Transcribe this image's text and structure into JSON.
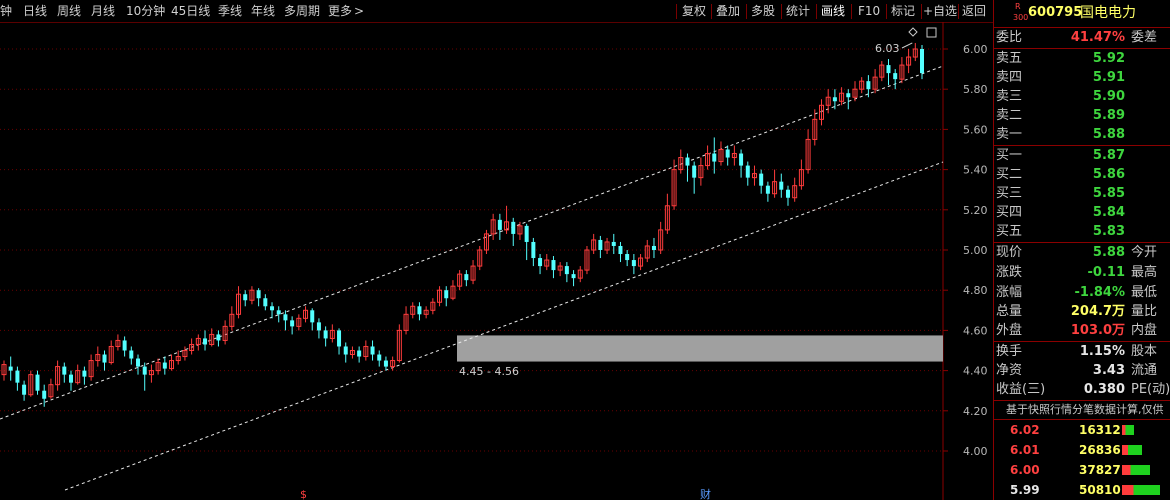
{
  "toolbar": {
    "periods": [
      "钟",
      "日线",
      "周线",
      "月线",
      "10分钟",
      "45日线",
      "季线",
      "年线",
      "多周期",
      "更多"
    ],
    "more_chevron": ">",
    "buttons": [
      "复权",
      "叠加",
      "多股",
      "统计",
      "画线",
      "F10",
      "标记",
      "+自选",
      "返回"
    ],
    "active_button": "画线"
  },
  "chart_data": {
    "type": "candlestick",
    "price_axis": [
      "6.00",
      "5.80",
      "5.60",
      "5.40",
      "5.20",
      "5.00",
      "4.80",
      "4.60",
      "4.40",
      "4.20",
      "4.00"
    ],
    "ylim": [
      3.9,
      6.1
    ],
    "high_label": "6.03",
    "zone_label": "4.45 - 4.56",
    "zone_range": [
      4.45,
      4.56
    ],
    "event_markers": [
      "$",
      "财"
    ],
    "candles": [
      [
        4.38,
        4.43,
        4.35,
        4.45
      ],
      [
        4.42,
        4.4,
        4.35,
        4.47
      ],
      [
        4.4,
        4.34,
        4.3,
        4.42
      ],
      [
        4.33,
        4.28,
        4.25,
        4.35
      ],
      [
        4.28,
        4.38,
        4.27,
        4.4
      ],
      [
        4.38,
        4.3,
        4.28,
        4.4
      ],
      [
        4.3,
        4.26,
        4.22,
        4.33
      ],
      [
        4.27,
        4.33,
        4.26,
        4.36
      ],
      [
        4.33,
        4.42,
        4.3,
        4.45
      ],
      [
        4.42,
        4.38,
        4.34,
        4.44
      ],
      [
        4.38,
        4.34,
        4.3,
        4.4
      ],
      [
        4.34,
        4.4,
        4.33,
        4.43
      ],
      [
        4.4,
        4.37,
        4.33,
        4.42
      ],
      [
        4.37,
        4.45,
        4.35,
        4.48
      ],
      [
        4.45,
        4.48,
        4.42,
        4.52
      ],
      [
        4.48,
        4.44,
        4.4,
        4.5
      ],
      [
        4.44,
        4.52,
        4.43,
        4.55
      ],
      [
        4.52,
        4.55,
        4.5,
        4.58
      ],
      [
        4.55,
        4.5,
        4.47,
        4.57
      ],
      [
        4.5,
        4.46,
        4.43,
        4.52
      ],
      [
        4.46,
        4.42,
        4.38,
        4.48
      ],
      [
        4.42,
        4.38,
        4.3,
        4.44
      ],
      [
        4.38,
        4.4,
        4.34,
        4.43
      ],
      [
        4.4,
        4.44,
        4.38,
        4.46
      ],
      [
        4.44,
        4.41,
        4.38,
        4.47
      ],
      [
        4.41,
        4.45,
        4.4,
        4.48
      ],
      [
        4.45,
        4.47,
        4.43,
        4.5
      ],
      [
        4.47,
        4.5,
        4.45,
        4.52
      ],
      [
        4.5,
        4.53,
        4.48,
        4.56
      ],
      [
        4.53,
        4.56,
        4.5,
        4.58
      ],
      [
        4.56,
        4.53,
        4.5,
        4.6
      ],
      [
        4.53,
        4.58,
        4.52,
        4.61
      ],
      [
        4.58,
        4.55,
        4.52,
        4.6
      ],
      [
        4.55,
        4.62,
        4.53,
        4.65
      ],
      [
        4.62,
        4.68,
        4.6,
        4.72
      ],
      [
        4.68,
        4.78,
        4.66,
        4.82
      ],
      [
        4.78,
        4.75,
        4.72,
        4.8
      ],
      [
        4.75,
        4.8,
        4.73,
        4.82
      ],
      [
        4.8,
        4.76,
        4.72,
        4.81
      ],
      [
        4.76,
        4.72,
        4.7,
        4.78
      ],
      [
        4.72,
        4.7,
        4.66,
        4.74
      ],
      [
        4.7,
        4.68,
        4.64,
        4.72
      ],
      [
        4.68,
        4.65,
        4.6,
        4.7
      ],
      [
        4.65,
        4.62,
        4.58,
        4.67
      ],
      [
        4.62,
        4.66,
        4.6,
        4.68
      ],
      [
        4.66,
        4.7,
        4.64,
        4.72
      ],
      [
        4.7,
        4.64,
        4.6,
        4.71
      ],
      [
        4.64,
        4.6,
        4.56,
        4.66
      ],
      [
        4.6,
        4.56,
        4.52,
        4.62
      ],
      [
        4.56,
        4.6,
        4.54,
        4.63
      ],
      [
        4.6,
        4.52,
        4.48,
        4.61
      ],
      [
        4.52,
        4.48,
        4.44,
        4.54
      ],
      [
        4.48,
        4.5,
        4.46,
        4.52
      ],
      [
        4.5,
        4.47,
        4.44,
        4.52
      ],
      [
        4.47,
        4.52,
        4.45,
        4.55
      ],
      [
        4.52,
        4.48,
        4.45,
        4.55
      ],
      [
        4.48,
        4.45,
        4.42,
        4.5
      ],
      [
        4.45,
        4.42,
        4.4,
        4.47
      ],
      [
        4.42,
        4.45,
        4.4,
        4.47
      ],
      [
        4.45,
        4.6,
        4.44,
        4.63
      ],
      [
        4.6,
        4.68,
        4.58,
        4.72
      ],
      [
        4.68,
        4.72,
        4.66,
        4.74
      ],
      [
        4.72,
        4.68,
        4.65,
        4.74
      ],
      [
        4.68,
        4.7,
        4.66,
        4.72
      ],
      [
        4.7,
        4.74,
        4.68,
        4.76
      ],
      [
        4.74,
        4.8,
        4.72,
        4.82
      ],
      [
        4.8,
        4.76,
        4.72,
        4.82
      ],
      [
        4.76,
        4.82,
        4.75,
        4.85
      ],
      [
        4.82,
        4.88,
        4.8,
        4.9
      ],
      [
        4.88,
        4.85,
        4.82,
        4.9
      ],
      [
        4.85,
        4.92,
        4.83,
        4.95
      ],
      [
        4.92,
        5.0,
        4.9,
        5.02
      ],
      [
        5.0,
        5.08,
        4.98,
        5.1
      ],
      [
        5.08,
        5.15,
        5.05,
        5.18
      ],
      [
        5.15,
        5.1,
        5.05,
        5.18
      ],
      [
        5.1,
        5.14,
        5.08,
        5.22
      ],
      [
        5.14,
        5.08,
        5.02,
        5.16
      ],
      [
        5.08,
        5.12,
        5.05,
        5.14
      ],
      [
        5.12,
        5.04,
        4.95,
        5.13
      ],
      [
        5.04,
        4.96,
        4.92,
        5.06
      ],
      [
        4.96,
        4.92,
        4.88,
        4.98
      ],
      [
        4.92,
        4.95,
        4.9,
        4.98
      ],
      [
        4.95,
        4.9,
        4.86,
        4.97
      ],
      [
        4.9,
        4.92,
        4.87,
        4.94
      ],
      [
        4.92,
        4.88,
        4.84,
        4.94
      ],
      [
        4.88,
        4.86,
        4.82,
        4.9
      ],
      [
        4.86,
        4.9,
        4.84,
        4.92
      ],
      [
        4.9,
        5.0,
        4.88,
        5.02
      ],
      [
        5.0,
        5.05,
        4.98,
        5.08
      ],
      [
        5.05,
        5.0,
        4.96,
        5.07
      ],
      [
        5.0,
        5.04,
        4.98,
        5.06
      ],
      [
        5.04,
        5.02,
        4.98,
        5.08
      ],
      [
        5.02,
        4.98,
        4.94,
        5.04
      ],
      [
        4.98,
        4.95,
        4.92,
        5.0
      ],
      [
        4.95,
        4.92,
        4.88,
        4.98
      ],
      [
        4.92,
        4.96,
        4.9,
        4.98
      ],
      [
        4.96,
        5.02,
        4.94,
        5.05
      ],
      [
        5.02,
        5.0,
        4.96,
        5.06
      ],
      [
        5.0,
        5.1,
        4.98,
        5.14
      ],
      [
        5.1,
        5.22,
        5.08,
        5.28
      ],
      [
        5.22,
        5.4,
        5.2,
        5.45
      ],
      [
        5.4,
        5.46,
        5.38,
        5.5
      ],
      [
        5.46,
        5.42,
        5.34,
        5.48
      ],
      [
        5.42,
        5.36,
        5.28,
        5.44
      ],
      [
        5.36,
        5.42,
        5.32,
        5.46
      ],
      [
        5.42,
        5.48,
        5.4,
        5.52
      ],
      [
        5.48,
        5.44,
        5.38,
        5.56
      ],
      [
        5.44,
        5.5,
        5.42,
        5.54
      ],
      [
        5.5,
        5.46,
        5.42,
        5.52
      ],
      [
        5.46,
        5.48,
        5.42,
        5.52
      ],
      [
        5.48,
        5.42,
        5.36,
        5.5
      ],
      [
        5.42,
        5.36,
        5.32,
        5.44
      ],
      [
        5.36,
        5.38,
        5.32,
        5.42
      ],
      [
        5.38,
        5.32,
        5.28,
        5.4
      ],
      [
        5.32,
        5.28,
        5.24,
        5.34
      ],
      [
        5.28,
        5.34,
        5.26,
        5.4
      ],
      [
        5.34,
        5.3,
        5.26,
        5.38
      ],
      [
        5.3,
        5.26,
        5.22,
        5.32
      ],
      [
        5.26,
        5.32,
        5.24,
        5.36
      ],
      [
        5.32,
        5.4,
        5.3,
        5.45
      ],
      [
        5.4,
        5.55,
        5.38,
        5.6
      ],
      [
        5.55,
        5.65,
        5.52,
        5.7
      ],
      [
        5.65,
        5.72,
        5.62,
        5.75
      ],
      [
        5.72,
        5.76,
        5.68,
        5.8
      ],
      [
        5.76,
        5.74,
        5.7,
        5.8
      ],
      [
        5.74,
        5.78,
        5.72,
        5.81
      ],
      [
        5.78,
        5.76,
        5.7,
        5.8
      ],
      [
        5.76,
        5.8,
        5.74,
        5.84
      ],
      [
        5.8,
        5.84,
        5.78,
        5.86
      ],
      [
        5.84,
        5.8,
        5.76,
        5.87
      ],
      [
        5.8,
        5.86,
        5.78,
        5.9
      ],
      [
        5.86,
        5.92,
        5.84,
        5.94
      ],
      [
        5.92,
        5.88,
        5.82,
        5.95
      ],
      [
        5.88,
        5.85,
        5.8,
        5.9
      ],
      [
        5.85,
        5.92,
        5.83,
        5.96
      ],
      [
        5.92,
        5.96,
        5.88,
        6.0
      ],
      [
        5.96,
        6.0,
        5.94,
        6.03
      ],
      [
        6.0,
        5.88,
        5.85,
        6.02
      ]
    ]
  },
  "panel": {
    "stock_badge_top": "R",
    "stock_badge_bottom": "300",
    "code": "600795",
    "name": "国电电力",
    "weibi_label": "委比",
    "weibi_value": "41.47%",
    "weicha_label": "委差",
    "asks": [
      {
        "label": "卖五",
        "price": "5.92"
      },
      {
        "label": "卖四",
        "price": "5.91"
      },
      {
        "label": "卖三",
        "price": "5.90"
      },
      {
        "label": "卖二",
        "price": "5.89"
      },
      {
        "label": "卖一",
        "price": "5.88"
      }
    ],
    "bids": [
      {
        "label": "买一",
        "price": "5.87"
      },
      {
        "label": "买二",
        "price": "5.86"
      },
      {
        "label": "买三",
        "price": "5.85"
      },
      {
        "label": "买四",
        "price": "5.84"
      },
      {
        "label": "买五",
        "price": "5.83"
      }
    ],
    "quote": [
      {
        "label": "现价",
        "value": "5.88",
        "right": "今开"
      },
      {
        "label": "涨跌",
        "value": "-0.11",
        "right": "最高"
      },
      {
        "label": "涨幅",
        "value": "-1.84%",
        "right": "最低"
      },
      {
        "label": "总量",
        "value": "204.7万",
        "right": "量比"
      },
      {
        "label": "外盘",
        "value": "103.0万",
        "right": "内盘"
      }
    ],
    "fund": [
      {
        "label": "换手",
        "value": "1.15%",
        "right": "股本"
      },
      {
        "label": "净资",
        "value": "3.43",
        "right": "流通"
      },
      {
        "label": "收益(三)",
        "value": "0.380",
        "right": "PE(动)"
      }
    ],
    "notice": "基于快照行情分笔数据计算,仅供",
    "ticks": [
      {
        "price": "6.02",
        "vol": "16312",
        "bar": 0.12
      },
      {
        "price": "6.01",
        "vol": "26836",
        "bar": 0.2
      },
      {
        "price": "6.00",
        "vol": "37827",
        "bar": 0.28
      },
      {
        "price": "5.99",
        "vol": "50810",
        "bar": 0.38
      }
    ],
    "colors": {
      "up": "#ff3c3c",
      "down": "#3ed63e",
      "cyan": "#54ffff",
      "border": "#8b0000"
    }
  }
}
